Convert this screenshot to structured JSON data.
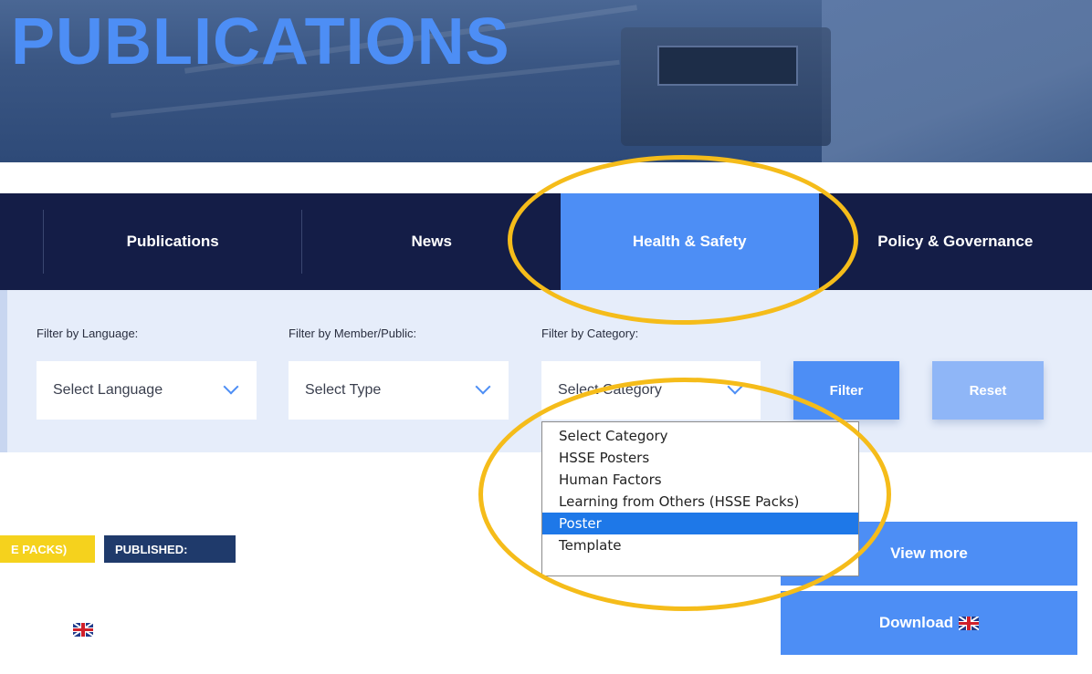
{
  "hero": {
    "title": "PUBLICATIONS"
  },
  "nav": {
    "tabs": [
      {
        "label": "Publications",
        "active": false
      },
      {
        "label": "News",
        "active": false
      },
      {
        "label": "Health & Safety",
        "active": true
      },
      {
        "label": "Policy & Governance",
        "active": false
      }
    ]
  },
  "filters": {
    "language": {
      "label": "Filter by Language:",
      "value": "Select Language"
    },
    "member": {
      "label": "Filter by Member/Public:",
      "value": "Select Type"
    },
    "category": {
      "label": "Filter by Category:",
      "value": "Select Category"
    },
    "filter_label": "Filter",
    "reset_label": "Reset"
  },
  "category_dropdown": {
    "options": [
      "Select Category",
      "HSSE Posters",
      "Human Factors",
      "Learning from Others (HSSE Packs)",
      "Poster",
      "Template"
    ],
    "highlighted": "Poster"
  },
  "listing": {
    "category_badge": "E PACKS)",
    "published_badge": "PUBLISHED:",
    "view_more_label": "View more",
    "download_label": "Download"
  },
  "colors": {
    "navy": "#141d47",
    "accent_blue": "#4d8ef5",
    "highlight_ring": "#f5bc1a",
    "badge_yellow": "#f5d21d"
  }
}
